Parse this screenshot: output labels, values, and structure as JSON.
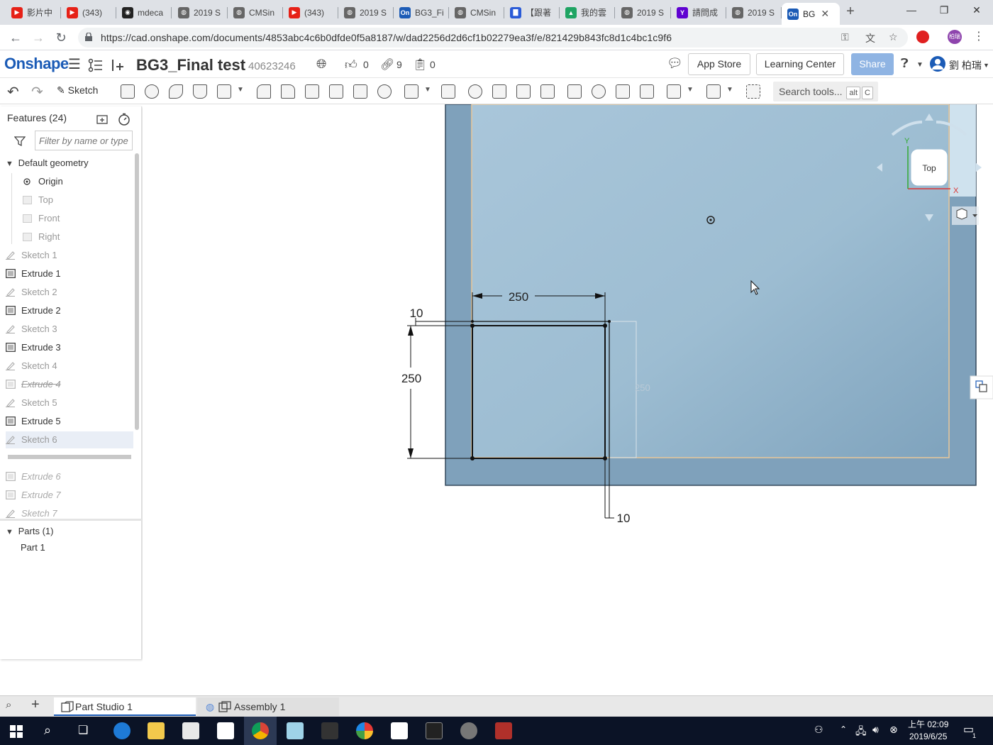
{
  "browser": {
    "tabs": [
      {
        "label": "影片中",
        "color": "#e62117",
        "glyph": "▶"
      },
      {
        "label": "(343) ",
        "color": "#e62117",
        "glyph": "▶"
      },
      {
        "label": "mdeca",
        "color": "#222222",
        "glyph": "◉"
      },
      {
        "label": "2019 S",
        "color": "#666666",
        "glyph": "◍"
      },
      {
        "label": "CMSin",
        "color": "#666666",
        "glyph": "◍"
      },
      {
        "label": "(343) ",
        "color": "#e62117",
        "glyph": "▶"
      },
      {
        "label": "2019 S",
        "color": "#666666",
        "glyph": "◍"
      },
      {
        "label": "BG3_Fi",
        "color": "#1b5bb6",
        "glyph": "On"
      },
      {
        "label": "CMSin",
        "color": "#666666",
        "glyph": "◍"
      },
      {
        "label": "【跟著",
        "color": "#2a5bd7",
        "glyph": "▇"
      },
      {
        "label": "我的雲",
        "color": "#1fa463",
        "glyph": "▲"
      },
      {
        "label": "2019 S",
        "color": "#666666",
        "glyph": "◍"
      },
      {
        "label": "請問成",
        "color": "#5f01d1",
        "glyph": "Y"
      },
      {
        "label": "2019 S",
        "color": "#666666",
        "glyph": "◍"
      },
      {
        "label": "BG",
        "color": "#1b5bb6",
        "glyph": "On",
        "active": true
      }
    ],
    "url": "https://cad.onshape.com/documents/4853abc4c6b0dfde0f5a8187/w/dad2256d2d6cf1b02279ea3f/e/821429b843fc8d1c4bc1c9f6",
    "profile_initials": "柏瑞"
  },
  "header": {
    "logo": "Onshape",
    "doc_title": "BG3_Final test",
    "doc_number": "40623246",
    "likes": "0",
    "links": "9",
    "copies": "0",
    "app_store": "App Store",
    "learning_center": "Learning Center",
    "share": "Share",
    "user_name": "劉 柏瑞"
  },
  "toolbar": {
    "sketch_label": "Sketch",
    "search_label": "Search tools...",
    "search_key1": "alt",
    "search_key2": "C"
  },
  "features": {
    "title": "Features (24)",
    "filter_placeholder": "Filter by name or type",
    "default_geometry": "Default geometry",
    "items": [
      {
        "label": "Origin",
        "kind": "origin",
        "state": "normal"
      },
      {
        "label": "Top",
        "kind": "plane",
        "state": "dim"
      },
      {
        "label": "Front",
        "kind": "plane",
        "state": "dim"
      },
      {
        "label": "Right",
        "kind": "plane",
        "state": "dim"
      },
      {
        "label": "Sketch 1",
        "kind": "sketch",
        "state": "dim"
      },
      {
        "label": "Extrude 1",
        "kind": "extrude",
        "state": "normal"
      },
      {
        "label": "Sketch 2",
        "kind": "sketch",
        "state": "dim"
      },
      {
        "label": "Extrude 2",
        "kind": "extrude",
        "state": "normal"
      },
      {
        "label": "Sketch 3",
        "kind": "sketch",
        "state": "dim"
      },
      {
        "label": "Extrude 3",
        "kind": "extrude",
        "state": "normal"
      },
      {
        "label": "Sketch 4",
        "kind": "sketch",
        "state": "dim"
      },
      {
        "label": "Extrude 4",
        "kind": "extrude",
        "state": "suppressed"
      },
      {
        "label": "Sketch 5",
        "kind": "sketch",
        "state": "dim"
      },
      {
        "label": "Extrude 5",
        "kind": "extrude",
        "state": "normal"
      },
      {
        "label": "Sketch 6",
        "kind": "sketch",
        "state": "selected"
      },
      {
        "label": "Extrude 6",
        "kind": "extrude",
        "state": "rolled"
      },
      {
        "label": "Extrude 7",
        "kind": "extrude",
        "state": "rolled"
      },
      {
        "label": "Sketch 7",
        "kind": "sketch",
        "state": "rolled"
      }
    ],
    "parts_header": "Parts (1)",
    "parts": [
      "Part 1"
    ]
  },
  "viewport": {
    "dims": {
      "width": "250",
      "height": "250",
      "offset_top": "10",
      "offset_right": "10",
      "ghost": "250"
    },
    "view_cube_label": "Top",
    "axis_x": "X",
    "axis_y": "Y"
  },
  "bottom_tabs": {
    "part_studio": "Part Studio 1",
    "assembly": "Assembly 1"
  },
  "taskbar": {
    "time": "上午 02:09",
    "date": "2019/6/25",
    "notifications": "1"
  }
}
